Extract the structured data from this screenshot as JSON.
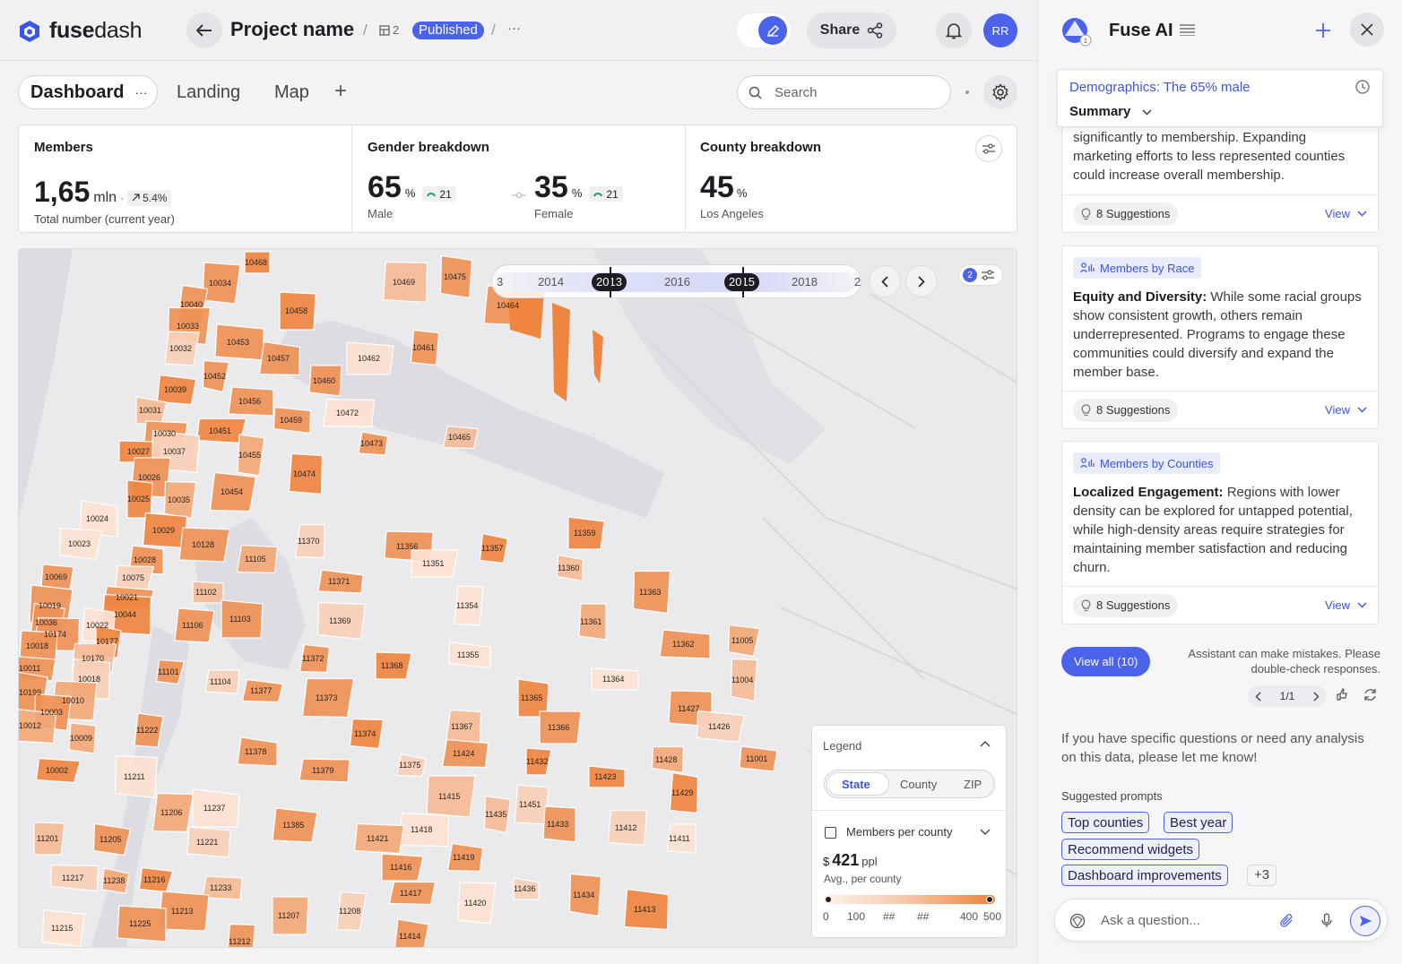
{
  "app": {
    "logo_text_bold": "fuse",
    "logo_text_light": "dash",
    "project_name": "Project name",
    "pages_count": "2",
    "status": "Published",
    "more": "···",
    "share": "Share",
    "user_initials": "RR"
  },
  "tabs": [
    {
      "label": "Dashboard",
      "more": "···"
    },
    {
      "label": "Landing"
    },
    {
      "label": "Map"
    },
    {
      "label": "+"
    }
  ],
  "search": {
    "placeholder": "Search"
  },
  "kpis": {
    "members": {
      "title": "Members",
      "value": "1,65",
      "unit": "mln",
      "change": "5.4%",
      "caption": "Total number (current year)"
    },
    "gender": {
      "title": "Gender breakdown",
      "male": {
        "value": "65",
        "unit": "%",
        "delta": "21",
        "label": "Male"
      },
      "female": {
        "value": "35",
        "unit": "%",
        "delta": "21",
        "label": "Female"
      }
    },
    "county": {
      "title": "County breakdown",
      "value": "45",
      "unit": "%",
      "label": "Los Angeles"
    }
  },
  "timeline": {
    "years": [
      "3",
      "2014",
      "2013",
      "2016",
      "2015",
      "2018",
      "2"
    ],
    "selected": [
      "2013",
      "2015"
    ],
    "filter_count": "2"
  },
  "legend": {
    "title": "Legend",
    "tabs": [
      "State",
      "County",
      "ZIP"
    ],
    "active_tab": "State",
    "metric": "Members per county",
    "value_prefix": "$",
    "value": "421",
    "value_unit": "ppl",
    "value_caption": "Avg., per county",
    "scale": [
      "0",
      "100",
      "##",
      "##",
      "400",
      "500"
    ]
  },
  "map": {
    "zip_labels": [
      "10468",
      "10475",
      "10034",
      "10469",
      "10464",
      "10040",
      "10458",
      "10033",
      "10453",
      "10461",
      "10032",
      "10457",
      "10462",
      "10452",
      "10460",
      "10039",
      "10456",
      "10472",
      "10031",
      "10459",
      "10030",
      "10451",
      "10473",
      "10465",
      "10027",
      "10037",
      "10455",
      "10474",
      "10026",
      "10454",
      "10025",
      "10035",
      "10024",
      "10029",
      "10128",
      "11370",
      "11359",
      "10023",
      "11356",
      "11357",
      "10028",
      "11105",
      "11351",
      "11360",
      "10069",
      "10075",
      "11371",
      "10021",
      "11102",
      "11363",
      "10019",
      "10044",
      "11354",
      "10036",
      "11103",
      "11369",
      "11361",
      "10022",
      "11106",
      "10174",
      "10177",
      "11005",
      "10018",
      "10170",
      "11362",
      "11372",
      "11368",
      "11355",
      "10011",
      "11101",
      "11104",
      "11377",
      "11364",
      "11004",
      "10199",
      "10018",
      "10010",
      "11373",
      "11365",
      "10003",
      "11427",
      "10012",
      "11222",
      "11367",
      "11366",
      "11426",
      "10009",
      "11374",
      "11378",
      "11424",
      "11432",
      "11428",
      "11001",
      "10002",
      "11379",
      "11375",
      "11423",
      "11211",
      "11415",
      "11429",
      "11451",
      "11206",
      "11237",
      "11435",
      "11433",
      "11412",
      "11385",
      "11418",
      "11201",
      "11205",
      "11221",
      "11421",
      "11411",
      "11419",
      "11416",
      "11217",
      "11238",
      "11216",
      "11233",
      "11417",
      "11436",
      "11434",
      "11420",
      "11413",
      "11213",
      "11208",
      "11207",
      "11215",
      "11225",
      "11212",
      "11414"
    ]
  },
  "assistant": {
    "title": "Fuse AI",
    "insight_link": "Demographics: The 65% male",
    "summary_label": "Summary",
    "summary_text": "significantly to membership. Expanding marketing efforts to less represented counties could increase overall membership.",
    "cards": [
      {
        "tag": "Members by Race",
        "heading": "Equity and Diversity:",
        "text": " While some racial groups show consistent growth, others remain underrepresented. Programs to engage these communities could diversify and expand the member base."
      },
      {
        "tag": "Members by Counties",
        "heading": "Localized Engagement:",
        "text": " Regions with lower density can be explored for untapped potential, while high-density areas require strategies for maintaining member satisfaction and reducing churn."
      }
    ],
    "suggestions_label": "8 Suggestions",
    "view_label": "View",
    "view_all": "View all (10)",
    "disclaimer": "Assistant can make mistakes. Please double-check responses.",
    "pager": "1/1",
    "info": "If you have specific questions or need any analysis on this data, please let me know!",
    "prompts_title": "Suggested prompts",
    "prompts": [
      "Top counties",
      "Best year",
      "Recommend widgets",
      "Dashboard improvements"
    ],
    "prompts_more": "+3",
    "ask_placeholder": "Ask a question..."
  },
  "colors": {
    "accent": "#4a63ea",
    "map_dark": "#ef8640",
    "map_light": "#fbdccb"
  }
}
